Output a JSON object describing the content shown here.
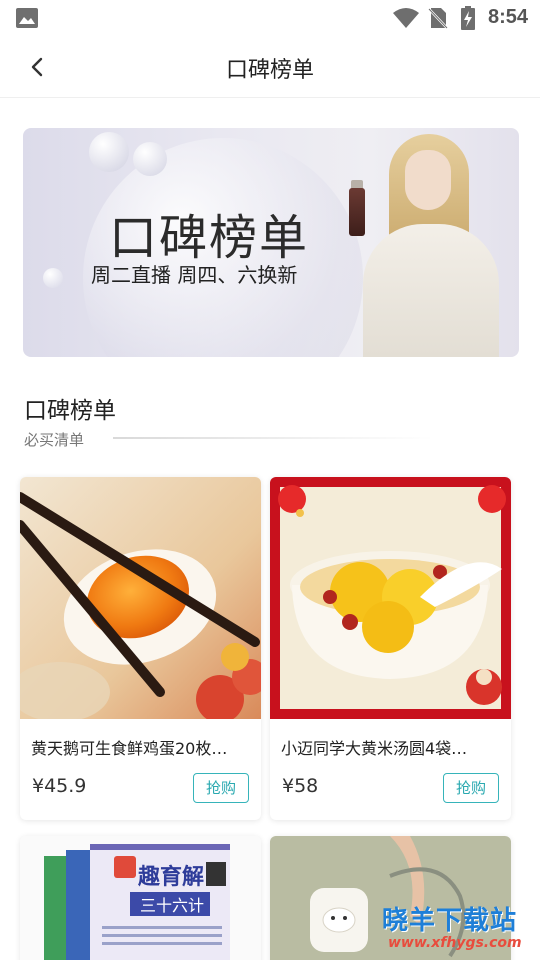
{
  "status_bar": {
    "time": "8:54"
  },
  "navbar": {
    "title": "口碑榜单"
  },
  "banner": {
    "title": "口碑榜单",
    "subtitle": "周二直播 周四、六换新"
  },
  "section": {
    "title": "口碑榜单",
    "subtitle": "必买清单"
  },
  "products": [
    {
      "name": "黄天鹅可生食鲜鸡蛋20枚…",
      "price": "¥45.9",
      "buy_label": "抢购"
    },
    {
      "name": "小迈同学大黄米汤圆4袋…",
      "price": "¥58",
      "buy_label": "抢购"
    },
    {
      "name": "",
      "price": "",
      "buy_label": ""
    },
    {
      "name": "",
      "price": "",
      "buy_label": ""
    }
  ],
  "product_images": {
    "p3_box_title": "趣育解",
    "p3_box_sub": "三十六计"
  },
  "watermark": {
    "main": "晓羊下载站",
    "url": "www.xfhygs.com"
  },
  "colors": {
    "accent": "#2aa9b0",
    "watermark_blue": "#1e7fd8",
    "watermark_red": "#e84c3d"
  }
}
